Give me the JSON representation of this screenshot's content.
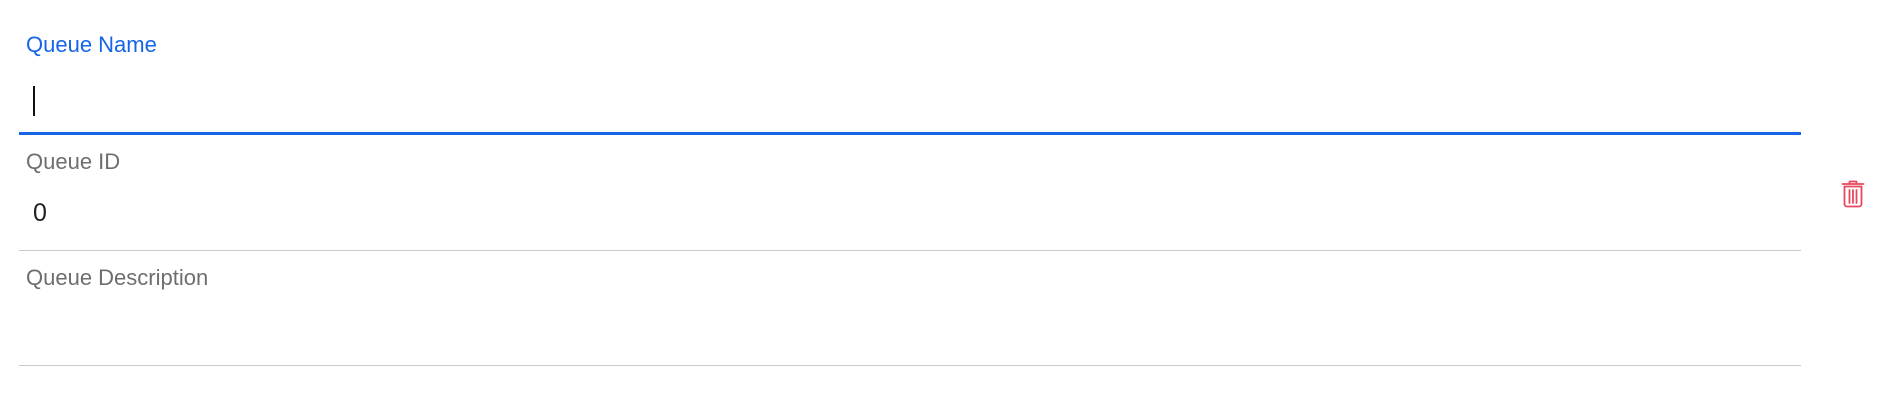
{
  "fields": [
    {
      "label": "Queue Name",
      "value": "",
      "placeholder": ""
    },
    {
      "label": "Queue ID",
      "value": "0",
      "placeholder": ""
    },
    {
      "label": "Queue Description",
      "value": "",
      "placeholder": ""
    }
  ],
  "delete_icon": {
    "name": "trash-icon",
    "color": "#e8485f"
  },
  "colors": {
    "accent": "#1565e6",
    "label": "#6e6e6e",
    "divider": "#c8c8c8",
    "danger": "#e8485f"
  }
}
